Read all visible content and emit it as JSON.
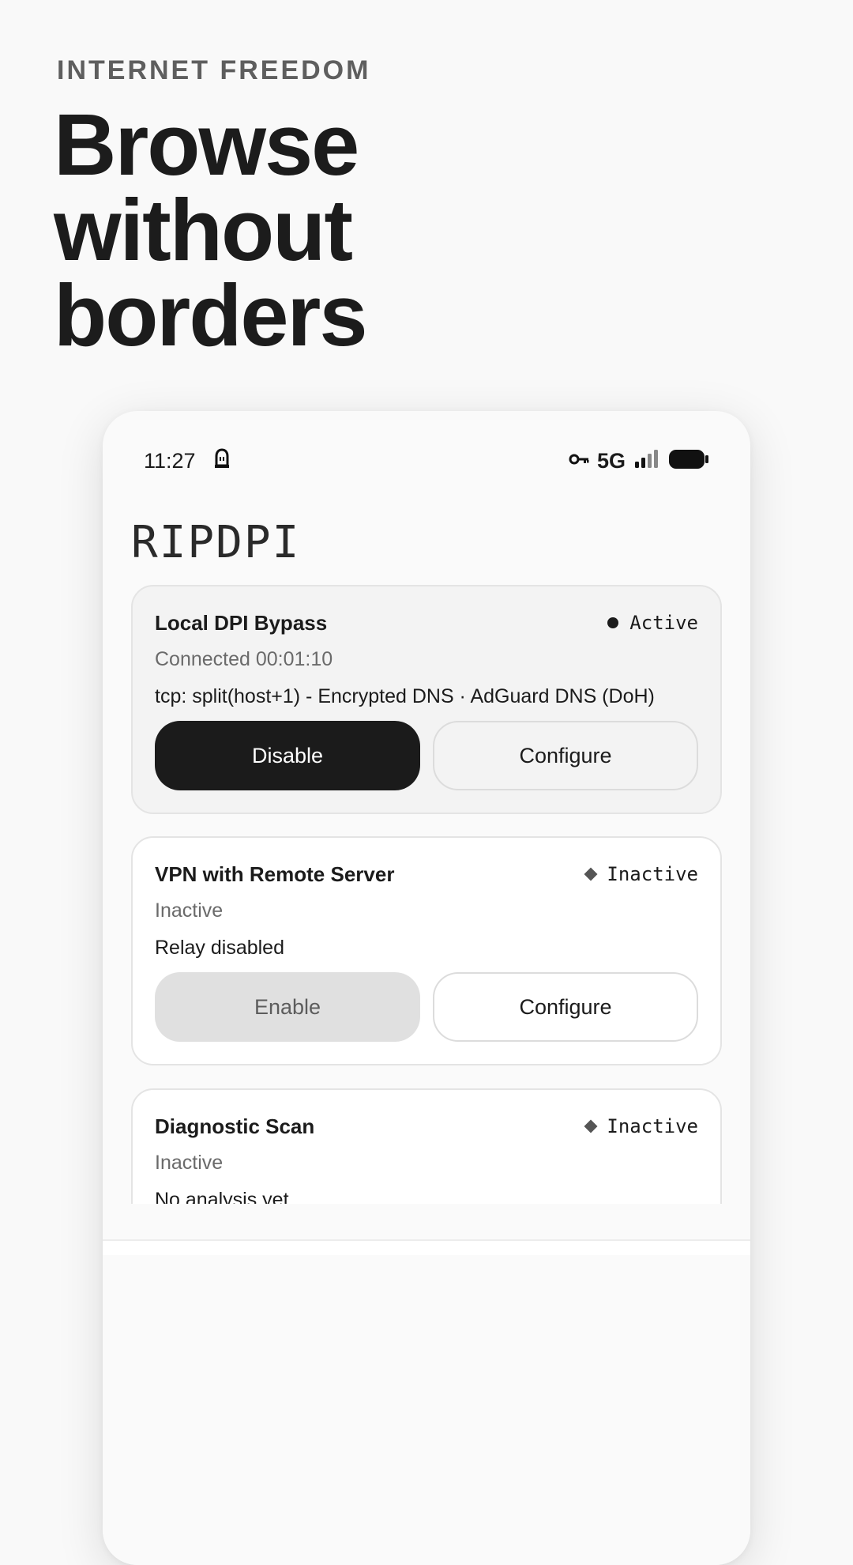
{
  "hero": {
    "eyebrow": "INTERNET FREEDOM",
    "headline": [
      "Browse",
      "without",
      "borders"
    ]
  },
  "statusbar": {
    "time": "11:27",
    "network": "5G",
    "icons": [
      "notification-lock-icon",
      "vpn-key-icon",
      "signal-icon",
      "battery-icon"
    ]
  },
  "app": {
    "title": "RIPDPI"
  },
  "cards": [
    {
      "title": "Local DPI Bypass",
      "status": "Active",
      "subtitle": "Connected 00:01:10",
      "detail": "tcp: split(host+1) - Encrypted DNS · AdGuard DNS (DoH)",
      "primary": "Disable",
      "secondary": "Configure"
    },
    {
      "title": "VPN with Remote Server",
      "status": "Inactive",
      "subtitle": "Inactive",
      "detail": "Relay disabled",
      "primary": "Enable",
      "secondary": "Configure"
    },
    {
      "title": "Diagnostic Scan",
      "status": "Inactive",
      "subtitle": "Inactive",
      "detail": "No analysis yet"
    }
  ],
  "colors": {
    "background": "#f9f9f9",
    "primary_button": "#1b1b1b",
    "disabled_button": "#e0e0e0",
    "card_border": "#e4e4e4"
  }
}
